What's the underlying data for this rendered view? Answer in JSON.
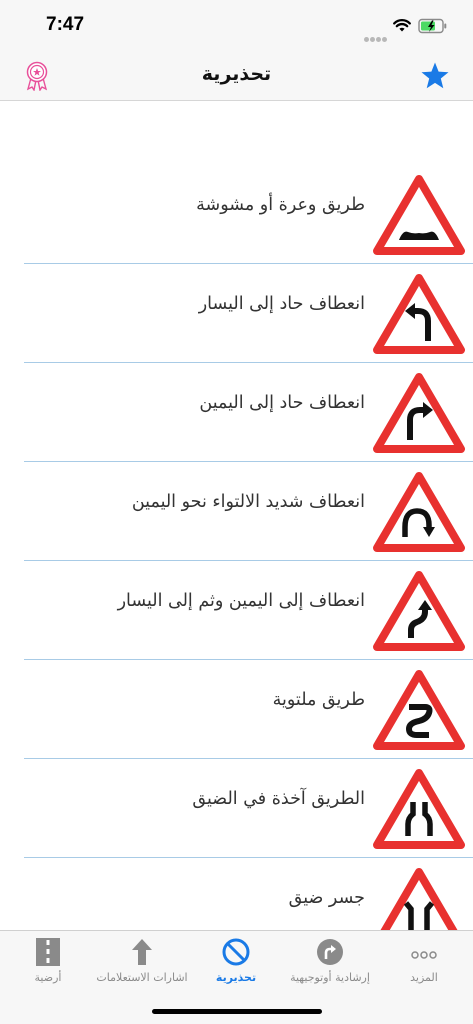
{
  "status": {
    "time": "7:47"
  },
  "nav": {
    "title": "تحذيرية"
  },
  "colors": {
    "accent": "#1a7ae6",
    "sign_red": "#e8312f",
    "badge_pink": "#e8509a",
    "separator": "#a8cbe6"
  },
  "signs": [
    {
      "label": "طريق وعرة أو مشوشة",
      "icon": "uneven-road-sign"
    },
    {
      "label": "انعطاف حاد إلى اليسار",
      "icon": "sharp-left-turn-sign"
    },
    {
      "label": "انعطاف حاد إلى اليمين",
      "icon": "sharp-right-turn-sign"
    },
    {
      "label": "انعطاف شديد الالتواء نحو اليمين",
      "icon": "hairpin-right-sign"
    },
    {
      "label": "انعطاف إلى اليمين وثم إلى اليسار",
      "icon": "double-bend-sign"
    },
    {
      "label": "طريق ملتوية",
      "icon": "winding-road-sign"
    },
    {
      "label": "الطريق آخذة في الضيق",
      "icon": "road-narrows-sign"
    },
    {
      "label": "جسر ضيق",
      "icon": "narrow-bridge-sign"
    }
  ],
  "tabs": [
    {
      "label": "المزيد",
      "icon": "more-icon"
    },
    {
      "label": "إرشادية أوتوجيهية",
      "icon": "guidance-icon"
    },
    {
      "label": "تحذيرية",
      "icon": "warning-icon",
      "active": true
    },
    {
      "label": "اشارات الاستعلامات",
      "icon": "info-signs-icon"
    },
    {
      "label": "أرضية",
      "icon": "road-markings-icon"
    }
  ]
}
